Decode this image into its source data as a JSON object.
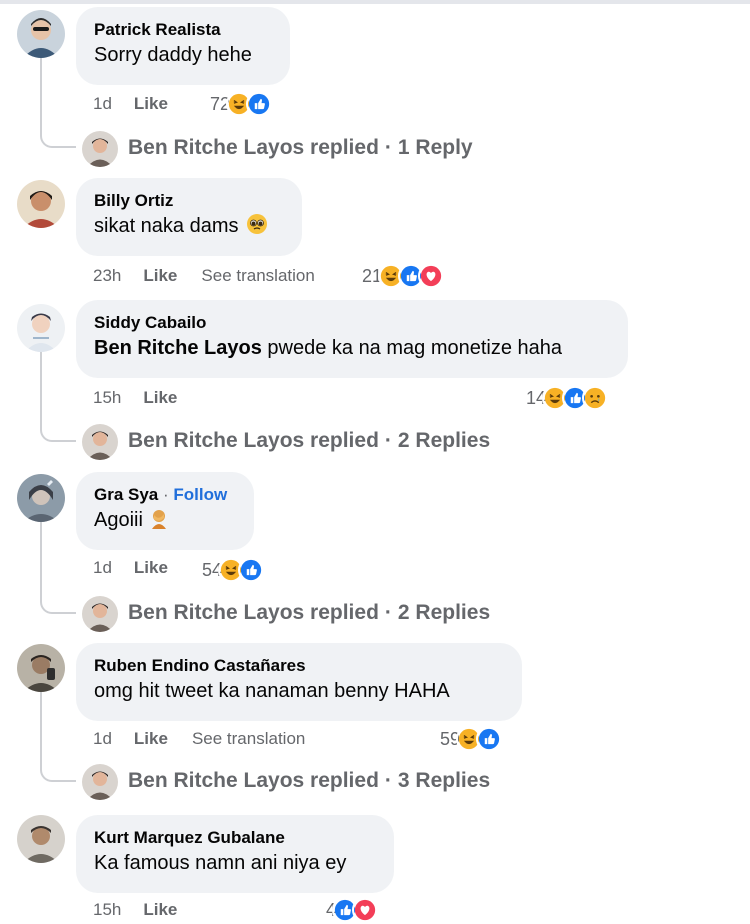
{
  "comments": [
    {
      "author": "Patrick Realista",
      "text": "Sorry daddy hehe",
      "time": "1d",
      "like": "Like",
      "reaction_count": "72",
      "reactions": [
        "haha",
        "like"
      ],
      "replies": {
        "name": "Ben Ritche Layos replied",
        "sep": "·",
        "count": "1 Reply"
      }
    },
    {
      "author": "Billy Ortiz",
      "text": "sikat naka dams",
      "emoji": "pleading",
      "time": "23h",
      "like": "Like",
      "see_translation": "See translation",
      "reaction_count": "21",
      "reactions": [
        "haha",
        "like",
        "love"
      ]
    },
    {
      "author": "Siddy Cabailo",
      "mention": "Ben Ritche Layos",
      "text": "pwede ka na mag monetize haha",
      "time": "15h",
      "like": "Like",
      "reaction_count": "14",
      "reactions": [
        "haha",
        "like",
        "sad"
      ],
      "replies": {
        "name": "Ben Ritche Layos replied",
        "sep": "·",
        "count": "2 Replies"
      }
    },
    {
      "author": "Gra Sya",
      "follow_sep": "·",
      "follow": "Follow",
      "text": "Agoiii",
      "emoji": "facepalm",
      "time": "1d",
      "like": "Like",
      "reaction_count": "54",
      "reactions": [
        "haha",
        "like"
      ],
      "replies": {
        "name": "Ben Ritche Layos replied",
        "sep": "·",
        "count": "2 Replies"
      }
    },
    {
      "author": "Ruben Endino Castañares",
      "text": "omg hit tweet ka nanaman benny HAHA",
      "time": "1d",
      "like": "Like",
      "see_translation": "See translation",
      "reaction_count": "59",
      "reactions": [
        "haha",
        "like"
      ],
      "replies": {
        "name": "Ben Ritche Layos replied",
        "sep": "·",
        "count": "3 Replies"
      }
    },
    {
      "author": "Kurt Marquez Gubalane",
      "text": "Ka famous namn ani niya ey",
      "time": "15h",
      "like": "Like",
      "reaction_count": "4",
      "reactions": [
        "like",
        "love"
      ]
    }
  ],
  "colors": {
    "bubble": "#f0f2f5",
    "meta_text": "#65676b",
    "follow": "#216fdb",
    "like_blue": "#1877f2",
    "love_red": "#f33e58",
    "haha_yellow": "#f7b125"
  }
}
